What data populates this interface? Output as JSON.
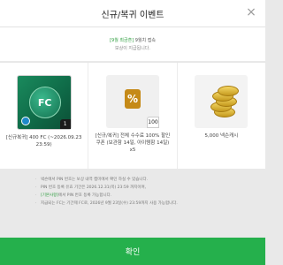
{
  "header": {
    "title": "신규/복귀 이벤트",
    "close_label": "×"
  },
  "notice": {
    "highlight": "[9월 최금흔]",
    "line1_rest": "9월치 접속",
    "line2": "보상이 지급됩니다."
  },
  "rewards": [
    {
      "icon": "fc-token-icon",
      "thumb_text": "FC",
      "count": "1",
      "label_line1": "[신규복귀] 400 FC (~2026.09.23",
      "label_line2": "23:59)"
    },
    {
      "icon": "discount-coupon-icon",
      "thumb_text": "%",
      "count": "100",
      "label_line1": "[신규/복귀] 전체 수수료 100% 할인",
      "label_line2": "쿠폰 (보관함 14일, 아이템함 14일)",
      "label_line3": "x5"
    },
    {
      "icon": "coins-icon",
      "label_line1": "5,000 넥슨캐시"
    }
  ],
  "info": [
    {
      "text": "넥슨에서 PIN 번호는 보상 내역 캡미에서 확인 하실 수 있습니다."
    },
    {
      "text": "PIN 번호 등록 유효 기간은 2026.12.31(목) 23:59 까지이며,"
    },
    {
      "highlight": "[기본사항]",
      "text": "에서 PIN 번호 등록 가능합니다."
    },
    {
      "text": "지급되는 FC는 기간제 FC로, 2026년 9월 23일(수) 23:59까지 사용 가능합니다."
    }
  ],
  "confirm_label": "확인",
  "colors": {
    "accent": "#25b04c",
    "highlight_text": "#2e9e3f",
    "coupon": "#c58a18"
  }
}
